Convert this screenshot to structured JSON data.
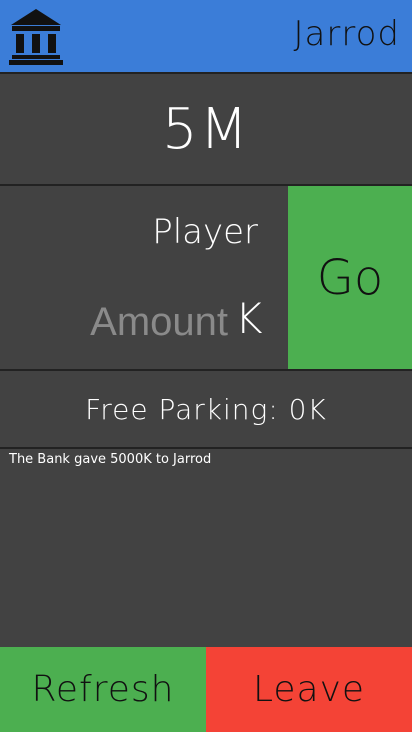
{
  "header": {
    "player_name": "Jarrod",
    "bank_icon": "bank-icon"
  },
  "balance": "5M",
  "transfer": {
    "player_label": "Player",
    "amount_placeholder": "Amount",
    "unit": "K",
    "go_label": "Go"
  },
  "free_parking": "Free Parking: 0K",
  "log": [
    "The Bank gave 5000K to Jarrod"
  ],
  "footer": {
    "refresh_label": "Refresh",
    "leave_label": "Leave"
  },
  "colors": {
    "header": "#3b7dd8",
    "background": "#424242",
    "go": "#4caf50",
    "refresh": "#4caf50",
    "leave": "#f44336"
  }
}
